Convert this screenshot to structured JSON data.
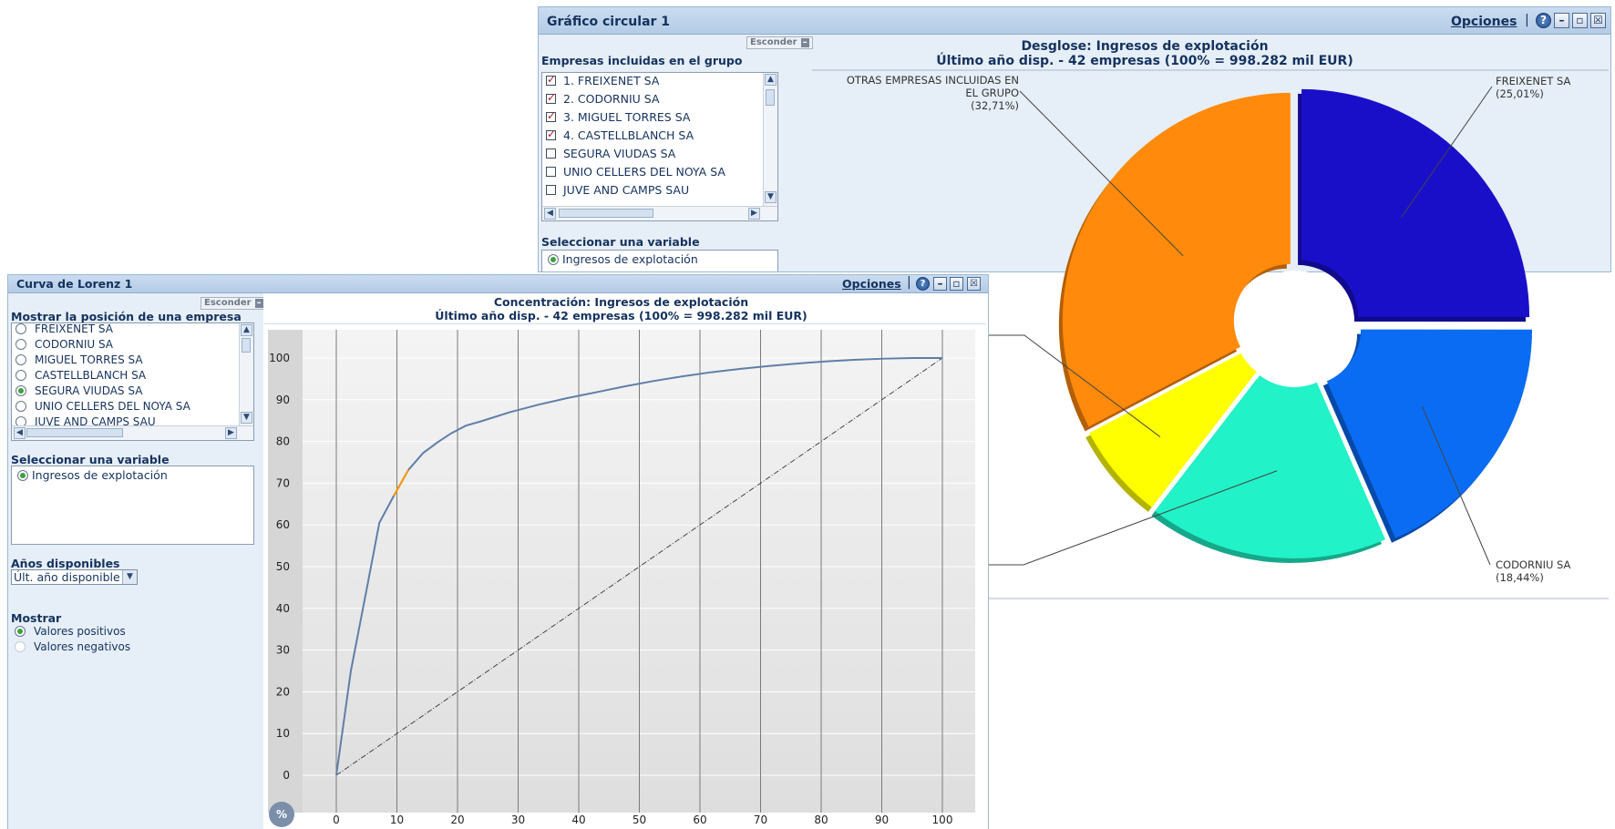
{
  "pie_window": {
    "title": "Gráfico circular 1",
    "options_label": "Opciones",
    "hide_label": "Esconder",
    "companies_heading": "Empresas incluidas en el grupo",
    "companies": [
      {
        "label": "1. FREIXENET SA",
        "checked": true
      },
      {
        "label": "2. CODORNIU SA",
        "checked": true
      },
      {
        "label": "3. MIGUEL TORRES SA",
        "checked": true
      },
      {
        "label": "4. CASTELLBLANCH SA",
        "checked": true
      },
      {
        "label": "SEGURA VIUDAS SA",
        "checked": false
      },
      {
        "label": "UNIO CELLERS DEL NOYA SA",
        "checked": false
      },
      {
        "label": "JUVE AND CAMPS SAU",
        "checked": false
      }
    ],
    "variable_heading": "Seleccionar una variable",
    "variable_option": "Ingresos de explotación",
    "chart_title_line1": "Desglose: Ingresos de explotación",
    "chart_title_line2": "Último año disp. - 42 empresas (100% = 998.282 mil EUR)"
  },
  "lorenz_window": {
    "title": "Curva de Lorenz 1",
    "options_label": "Opciones",
    "hide_label": "Esconder",
    "position_heading": "Mostrar la posición de una empresa",
    "companies": [
      {
        "label": "FREIXENET SA",
        "selected": false
      },
      {
        "label": "CODORNIU SA",
        "selected": false
      },
      {
        "label": "MIGUEL TORRES SA",
        "selected": false
      },
      {
        "label": "CASTELLBLANCH SA",
        "selected": false
      },
      {
        "label": "SEGURA VIUDAS SA",
        "selected": true
      },
      {
        "label": "UNIO CELLERS DEL NOYA SA",
        "selected": false
      },
      {
        "label": "JUVE AND CAMPS SAU",
        "selected": false
      }
    ],
    "variable_heading": "Seleccionar una variable",
    "variable_option": "Ingresos de explotación",
    "years_heading": "Años disponibles",
    "years_value": "Últ. año disponible",
    "show_heading": "Mostrar",
    "show_options": [
      {
        "label": "Valores positivos",
        "selected": true
      },
      {
        "label": "Valores negativos",
        "selected": false
      }
    ],
    "chart_title_line1": "Concentración: Ingresos de explotación",
    "chart_title_line2": "Último año disp. - 42 empresas (100% = 998.282 mil EUR)",
    "percent_button": "%"
  },
  "colors": {
    "pie_freixenet": "#1a0fc9",
    "pie_codorniu": "#0a6cf2",
    "pie_cyan": "#22f2c8",
    "pie_yellow": "#ffff00",
    "pie_otras": "#ff8a0c",
    "lorenz_curve": "#5f7fa8",
    "lorenz_highlight": "#ff9900"
  },
  "chart_data": [
    {
      "type": "pie",
      "title": "Desglose: Ingresos de explotación",
      "subtitle": "Último año disp. - 42 empresas (100% = 998.282 mil EUR)",
      "slices": [
        {
          "label": "FREIXENET SA",
          "pct_text": "(25,01%)",
          "value": 25.01
        },
        {
          "label": "CODORNIU SA",
          "pct_text": "(18,44%)",
          "value": 18.44
        },
        {
          "label": "",
          "pct_text": "",
          "value": 17.0
        },
        {
          "label": "",
          "pct_text": "",
          "value": 6.84
        },
        {
          "label": "OTRAS EMPRESAS INCLUIDAS EN EL GRUPO",
          "pct_text": "(32,71%)",
          "value": 32.71
        }
      ]
    },
    {
      "type": "line",
      "title": "Concentración: Ingresos de explotación",
      "subtitle": "Último año disp. - 42 empresas (100% = 998.282 mil EUR)",
      "x_ticks": [
        0,
        10,
        20,
        30,
        40,
        50,
        60,
        70,
        80,
        90,
        100
      ],
      "y_ticks": [
        0,
        10,
        20,
        30,
        40,
        50,
        60,
        70,
        80,
        90,
        100
      ],
      "xlim": [
        0,
        100
      ],
      "ylim": [
        0,
        100
      ],
      "grid": true,
      "series": [
        {
          "x": [
            0,
            2.4,
            4.8,
            7.1,
            9.5,
            11.9,
            14.3,
            16.7,
            19.0,
            21.4,
            23.8,
            28.6,
            33.3,
            38.1,
            42.9,
            47.6,
            52.4,
            57.1,
            61.9,
            66.7,
            71.4,
            76.2,
            81.0,
            85.7,
            90.5,
            95.2,
            100
          ],
          "y": [
            0,
            25,
            43,
            60.5,
            67,
            73.2,
            77.2,
            79.8,
            82,
            83.8,
            84.8,
            87,
            88.8,
            90.4,
            91.8,
            93.2,
            94.5,
            95.6,
            96.6,
            97.4,
            98.1,
            98.7,
            99.2,
            99.6,
            99.85,
            100,
            100
          ]
        },
        {
          "x": [
            0,
            100
          ],
          "y": [
            0,
            100
          ],
          "style": "dash-dot"
        }
      ],
      "highlight": {
        "label": "SEGURA VIUDAS SA",
        "x": [
          9.5,
          11.9
        ],
        "y": [
          67,
          73.2
        ]
      }
    }
  ]
}
